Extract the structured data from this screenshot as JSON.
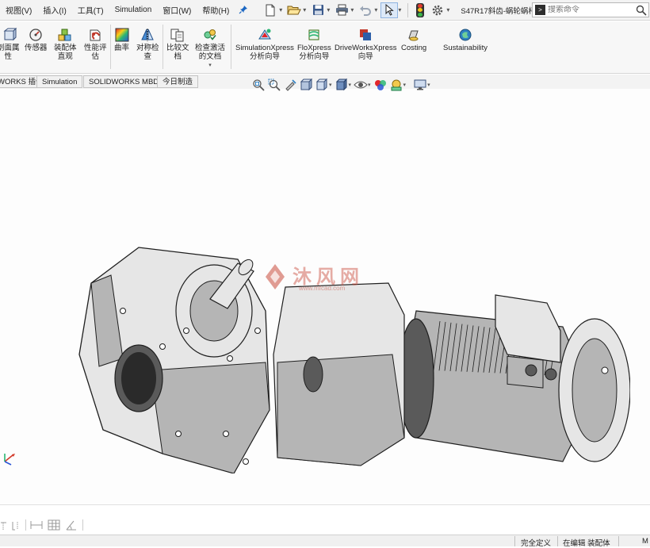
{
  "menu": {
    "items": [
      "视图(V)",
      "插入(I)",
      "工具(T)",
      "Simulation",
      "窗口(W)",
      "帮助(H)"
    ]
  },
  "quick_access": {
    "icons": [
      "new-document-icon",
      "open-icon",
      "save-icon",
      "print-icon",
      "undo-icon",
      "select-icon",
      "rebuild-icon",
      "options-icon"
    ]
  },
  "document": {
    "title": "S47R17斜齿-蜗轮蜗杆减..."
  },
  "command_search": {
    "placeholder": "搜索命令"
  },
  "ribbon": {
    "buttons": [
      {
        "id": "section-props",
        "label": "剖面属性",
        "icon": "section-properties-icon"
      },
      {
        "id": "sensor",
        "label": "传感器",
        "icon": "sensor-icon"
      },
      {
        "id": "assembly-vis",
        "label": "装配体直观",
        "icon": "assembly-visualization-icon"
      },
      {
        "id": "perf-eval",
        "label": "性能评估",
        "icon": "performance-evaluation-icon"
      },
      {
        "id": "curvature",
        "label": "曲率",
        "icon": "curvature-icon"
      },
      {
        "id": "symmetry",
        "label": "对称检查",
        "icon": "symmetry-check-icon"
      },
      {
        "id": "compare",
        "label": "比较文档",
        "icon": "compare-documents-icon"
      },
      {
        "id": "check-active",
        "label": "检查激活的文档",
        "icon": "check-active-document-icon"
      },
      {
        "id": "simxpress",
        "label": "SimulationXpress 分析向导",
        "icon": "simulationxpress-icon"
      },
      {
        "id": "floxpress",
        "label": "FloXpress 分析向导",
        "icon": "floxpress-icon"
      },
      {
        "id": "driveworks",
        "label": "DriveWorksXpress 向导",
        "icon": "driveworksxpress-icon"
      },
      {
        "id": "costing",
        "label": "Costing",
        "icon": "costing-icon"
      },
      {
        "id": "sustain",
        "label": "Sustainability",
        "icon": "sustainability-icon"
      }
    ],
    "label_lines": {
      "section_props": [
        "剖面属",
        "性"
      ],
      "assembly_vis": [
        "装配体",
        "直观"
      ],
      "perf_eval": [
        "性能评",
        "估"
      ],
      "symmetry": [
        "对称检",
        "查"
      ],
      "compare": [
        "比较文",
        "档"
      ],
      "check_active": [
        "检查激活",
        "的文档"
      ],
      "simxpress": [
        "SimulationXpress",
        "分析向导"
      ],
      "floxpress": [
        "FloXpress",
        "分析向导"
      ],
      "driveworks": [
        "DriveWorksXpress",
        "向导"
      ]
    }
  },
  "tabs": [
    "WORKS 插件",
    "Simulation",
    "SOLIDWORKS MBD",
    "今日制造"
  ],
  "hud": {
    "icons": [
      "zoom-to-fit-icon",
      "zoom-area-icon",
      "previous-view-icon",
      "section-view-icon",
      "view-orientation-icon",
      "display-style-icon",
      "hide-show-icon",
      "edit-appearance-icon",
      "apply-scene-icon",
      "view-settings-icon"
    ]
  },
  "watermark": {
    "text": "沐风网",
    "url_text": "www.mfcad.com"
  },
  "status": {
    "defined": "完全定义",
    "editing": "在编辑 装配体",
    "units": "M"
  },
  "colors": {
    "accent": "#1a66c2",
    "model_light": "#e6e6e6",
    "model_mid": "#b5b5b5",
    "model_dark": "#5a5a5a",
    "outline": "#1e1e1e",
    "watermark": "#c94a3a"
  }
}
